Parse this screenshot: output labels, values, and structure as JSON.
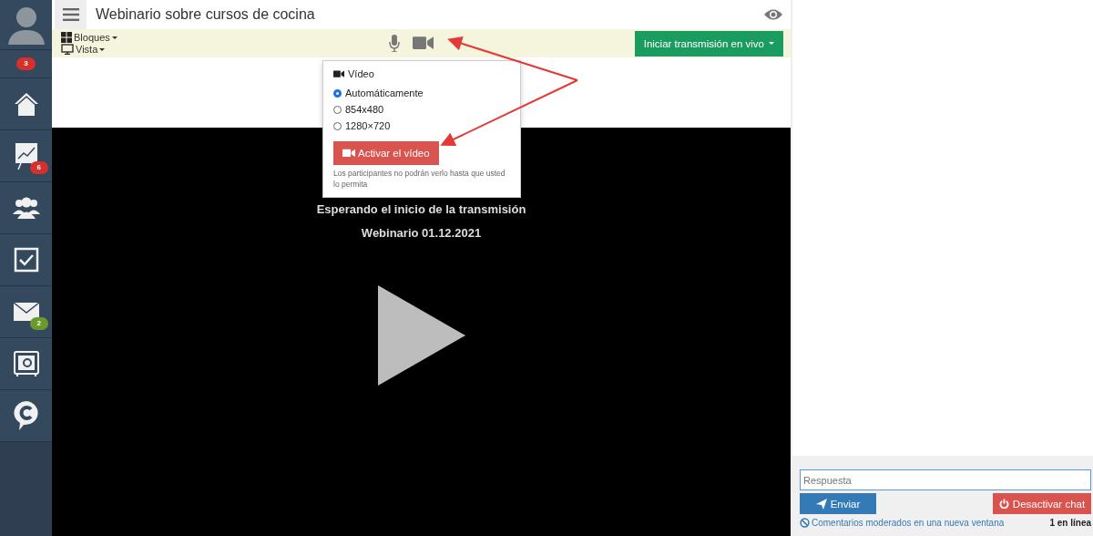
{
  "sidebar": {
    "profile_badge": {
      "text": "3",
      "color": "#d7302c"
    },
    "items": [
      {
        "kind": "home"
      },
      {
        "kind": "chart",
        "badge": {
          "text": "6",
          "color": "#d7302c"
        }
      },
      {
        "kind": "users"
      },
      {
        "kind": "tasks"
      },
      {
        "kind": "mail",
        "badge": {
          "text": "2",
          "color": "#6b9a2c"
        }
      },
      {
        "kind": "safe"
      },
      {
        "kind": "chat"
      }
    ]
  },
  "header": {
    "title": "Webinario sobre cursos de cocina"
  },
  "toolbar": {
    "menus": [
      {
        "kind": "blocks",
        "label": "Bloques"
      },
      {
        "kind": "view",
        "label": "Vista"
      }
    ],
    "live_button": "Iniciar transmisión en vivo"
  },
  "video_popup": {
    "title": "Vídeo",
    "options": [
      {
        "label": "Automáticamente",
        "selected": true
      },
      {
        "label": "854x480",
        "selected": false
      },
      {
        "label": "1280×720",
        "selected": false
      }
    ],
    "button": "Activar el vídeo",
    "note": "Los participantes no podrán verlo hasta que usted lo permita"
  },
  "player": {
    "status": "Esperando el inicio de la transmisión",
    "name": "Webinario 01.12.2021"
  },
  "chat": {
    "placeholder": "Respuesta",
    "send": "Enviar",
    "disable": "Desactivar chat",
    "moderated_link": "Comentarios moderados en una nueva ventana",
    "online": "1 en línea"
  }
}
